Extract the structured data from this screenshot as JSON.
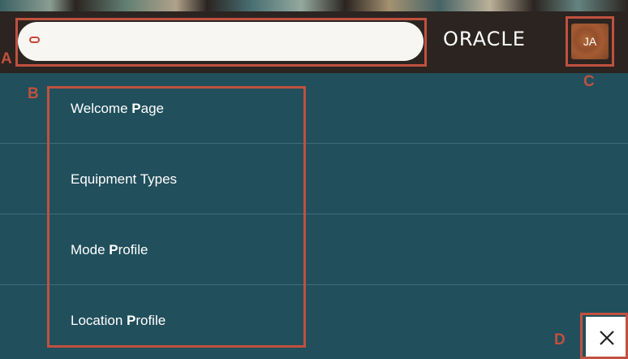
{
  "header": {
    "search": {
      "value": "",
      "placeholder": ""
    },
    "logo_text": "ORACLE",
    "avatar_initials": "JA"
  },
  "nav": {
    "items": [
      {
        "pre": "Welcome ",
        "key": "P",
        "post": "age"
      },
      {
        "pre": "Equipment Types",
        "key": "",
        "post": ""
      },
      {
        "pre": "Mode ",
        "key": "P",
        "post": "rofile"
      },
      {
        "pre": "Location ",
        "key": "P",
        "post": "rofile"
      }
    ]
  },
  "annotations": {
    "a": "A",
    "b": "B",
    "c": "C",
    "d": "D"
  },
  "colors": {
    "header_bg": "#2b2421",
    "nav_bg": "#214f5c",
    "annotation": "#c0513f",
    "search_icon": "#c74634"
  },
  "icons": {
    "search": "search-icon",
    "close": "close-icon"
  }
}
